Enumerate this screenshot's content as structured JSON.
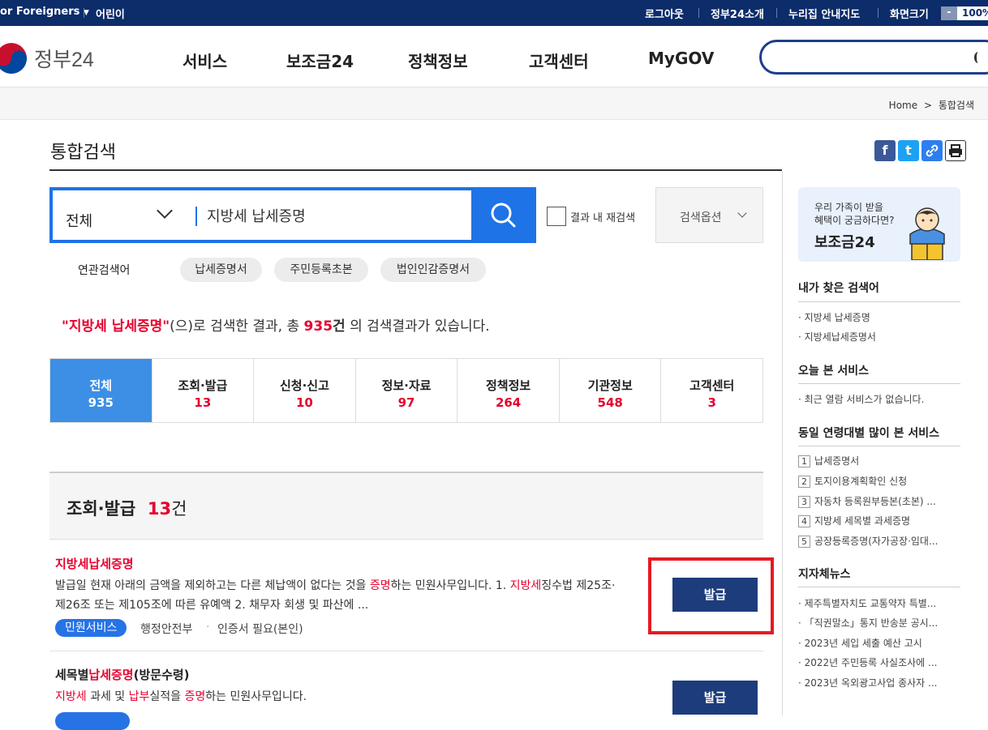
{
  "topbar": {
    "foreigners": "or Foreigners",
    "kids": "어린이",
    "logout": "로그아웃",
    "about": "정부24소개",
    "sitemap": "누리집 안내지도",
    "screen_size": "화면크기",
    "zoom_minus": "-",
    "zoom": "100%"
  },
  "header": {
    "logo_text": "정부24",
    "nav": [
      "서비스",
      "보조금24",
      "정책정보",
      "고객센터",
      "MyGOV"
    ]
  },
  "breadcrumb": {
    "home": "Home",
    "sep": ">",
    "current": "통합검색"
  },
  "page": {
    "title": "통합검색"
  },
  "share": {
    "facebook": "f",
    "twitter": "t"
  },
  "search": {
    "category": "전체",
    "query": "지방세 납세증명",
    "research_label": "결과 내 재검색",
    "options_label": "검색옵션"
  },
  "related": {
    "label": "연관검색어",
    "terms": [
      "납세증명서",
      "주민등록초본",
      "법인인감증명서"
    ]
  },
  "result_summary": {
    "query_quoted": "\"지방세 납세증명\"",
    "text1": "(으)로 검색한 결과, 총 ",
    "count": "935",
    "unit": "건",
    "text2": " 의 검색결과가 있습니다."
  },
  "tabs": [
    {
      "name": "전체",
      "count": "935"
    },
    {
      "name": "조회·발급",
      "count": "13"
    },
    {
      "name": "신청·신고",
      "count": "10"
    },
    {
      "name": "정보·자료",
      "count": "97"
    },
    {
      "name": "정책정보",
      "count": "264"
    },
    {
      "name": "기관정보",
      "count": "548"
    },
    {
      "name": "고객센터",
      "count": "3"
    }
  ],
  "section": {
    "title": "조회·발급",
    "count": "13",
    "unit": "건"
  },
  "items": [
    {
      "title": "지방세납세증명",
      "desc1_a": "발급일 현재 아래의 금액을 제외하고는 다른 체납액이 없다는 것을 ",
      "desc1_b": "증명",
      "desc1_c": "하는 민원사무입니다. 1. ",
      "desc1_d": "지방세",
      "desc1_e": "징수법 제25조·",
      "desc2": "제26조 또는 제105조에 따른 유예액 2. 채무자 회생 및 파산에 ...",
      "badge": "민원서비스",
      "agency": "행정안전부",
      "dot": "·",
      "auth": "인증서 필요(본인)",
      "button": "발급"
    },
    {
      "title_a": "세목별",
      "title_b": "납세증명",
      "title_c": "(방문수령)",
      "desc_a": "지방세",
      "desc_b": " 과세 및 ",
      "desc_c": "납부",
      "desc_d": "실적을 ",
      "desc_e": "증명",
      "desc_f": "하는 민원사무입니다.",
      "button": "발급"
    }
  ],
  "sidebar": {
    "banner_line1": "우리 가족이 받을",
    "banner_line2": "혜택이 궁금하다면?",
    "banner_title": "보조금24",
    "my_searches_title": "내가 찾은 검색어",
    "my_searches": [
      "지방세 납세증명",
      "지방세납세증명서"
    ],
    "today_title": "오늘 본 서비스",
    "today_empty": "최근 열람 서비스가 없습니다.",
    "popular_title": "동일 연령대별 많이 본 서비스",
    "popular": [
      {
        "n": "1",
        "t": "납세증명서"
      },
      {
        "n": "2",
        "t": "토지이용계획확인 신청"
      },
      {
        "n": "3",
        "t": "자동차 등록원부등본(초본) ..."
      },
      {
        "n": "4",
        "t": "지방세 세목별 과세증명"
      },
      {
        "n": "5",
        "t": "공장등록증명(자가공장·임대..."
      }
    ],
    "news_title": "지자체뉴스",
    "news": [
      "제주특별자치도 교통약자 특별...",
      "「직권말소」통지 반송분 공시...",
      "2023년 세입 세출 예산 고시",
      "2022년 주민등록 사실조사에 ...",
      "2023년 옥외광고사업 종사자 ..."
    ]
  }
}
